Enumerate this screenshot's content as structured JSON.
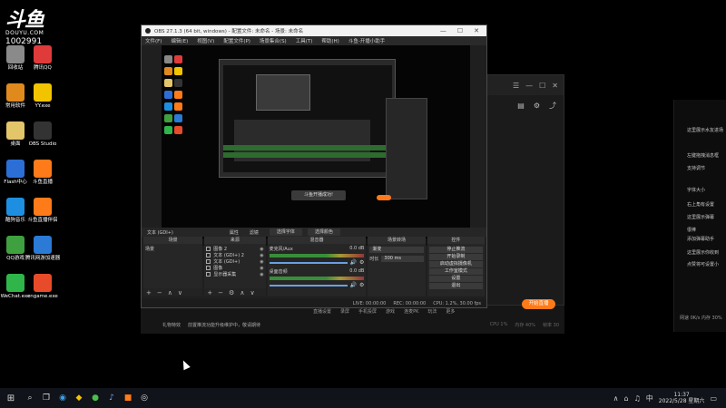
{
  "watermark": {
    "logo": "斗鱼",
    "site": "DOUYU.COM",
    "number": "1002991"
  },
  "desktop_icons": [
    {
      "label": "回收站",
      "color": "#8a8a8a"
    },
    {
      "label": "腾讯QQ",
      "color": "#e03b3b"
    },
    {
      "label": "常用软件",
      "color": "#e08a1e"
    },
    {
      "label": "YY.exe",
      "color": "#f2c400"
    },
    {
      "label": "桌面",
      "color": "#e3c56a"
    },
    {
      "label": "OBS Studio",
      "color": "#333333"
    },
    {
      "label": "Flash中心",
      "color": "#2b6fd6"
    },
    {
      "label": "斗鱼直播",
      "color": "#ff7a19"
    },
    {
      "label": "酷狗音乐",
      "color": "#1e8fe0"
    },
    {
      "label": "斗鱼直播伴侣",
      "color": "#ff7a19"
    },
    {
      "label": "QQ游戏",
      "color": "#3fa03f"
    },
    {
      "label": "腾讯网游加速器",
      "color": "#2a7ad6"
    },
    {
      "label": "WeChat.exe",
      "color": "#2fb54a"
    },
    {
      "label": "cngame.exe",
      "color": "#e84b2a"
    }
  ],
  "obs": {
    "title": "OBS 27.1.3 (64 bit, windows) - 配置文件: 未命名 - 场景: 未命名",
    "menu": [
      "文件(F)",
      "编辑(E)",
      "视图(V)",
      "配置文件(P)",
      "场景集合(S)",
      "工具(T)",
      "帮助(H)",
      "斗鱼-开播小助手"
    ],
    "toolbar": {
      "source_label": "文本 (GDI+)",
      "properties": "属性",
      "filters": "滤镜",
      "select_font": "选择字体",
      "select_color": "选择颜色"
    },
    "docks": {
      "scenes_header": "场景",
      "scene_item": "场景",
      "sources_header": "来源",
      "sources": [
        "图像 2",
        "文本 (GDI+) 2",
        "文本 (GDI+)",
        "图像",
        "显示器采集"
      ],
      "mixer_header": "混音器",
      "mixer": [
        {
          "name": "麦克风/Aux",
          "value": "0.0 dB"
        },
        {
          "name": "桌面音频",
          "value": "0.0 dB"
        }
      ],
      "transitions_header": "场景转场",
      "transition_value": "渐变",
      "duration_label": "时长",
      "duration_value": "300 ms",
      "controls_header": "控件",
      "controls": [
        "停止推流",
        "开始录制",
        "启动虚拟摄像机",
        "工作室模式",
        "设置",
        "退出"
      ]
    },
    "status": {
      "live": "LIVE: 00:00:00",
      "rec": "REC: 00:00:00",
      "cpu": "CPU: 1.2%, 30.00 fps"
    },
    "toast": "斗鱼开播成功!"
  },
  "douyu_bar": {
    "menu": [
      "直播设置",
      "录屏",
      "手机投屏",
      "游戏",
      "连麦PK",
      "玩法",
      "更多"
    ],
    "notice_left": "礼物特效",
    "notice_text": "前置推流功能升级维护中，敬请期待",
    "right_info": [
      "CPU 1%",
      "内存 40%",
      "帧率 30"
    ],
    "start_live": "开始直播"
  },
  "chat": {
    "lines": [
      "这里展示水友进场",
      "左键拖拽消息框",
      "支持调节",
      "字体大小",
      "右上角有设置",
      "这里展示弹幕",
      "很棒",
      "添加弹幕助手",
      "这里展示你收到",
      "点赞将可设置小"
    ],
    "bottom": "网速 0K/s 内存 30%"
  },
  "taskbar": {
    "time": "11:37",
    "date": "2022/5/28 星期六"
  }
}
